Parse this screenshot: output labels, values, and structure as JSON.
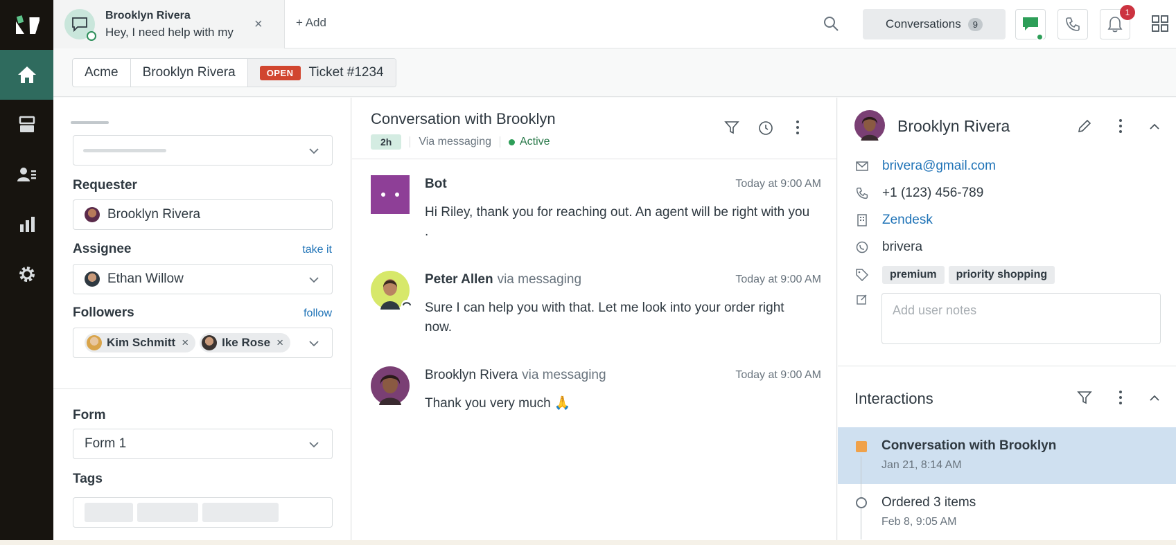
{
  "nav": {
    "items": [
      {
        "icon": "home-icon",
        "active": true
      },
      {
        "icon": "views-icon",
        "active": false
      },
      {
        "icon": "customers-icon",
        "active": false
      },
      {
        "icon": "reporting-icon",
        "active": false
      },
      {
        "icon": "settings-icon",
        "active": false
      }
    ]
  },
  "topbar": {
    "tab": {
      "name": "Brooklyn Rivera",
      "preview": "Hey, I need help with my"
    },
    "add_label": "+ Add",
    "conversations_label": "Conversations",
    "conversations_count": "9",
    "notification_count": "1"
  },
  "breadcrumb": {
    "org": "Acme",
    "requester": "Brooklyn Rivera",
    "status": "OPEN",
    "ticket": "Ticket #1234"
  },
  "ticket": {
    "requester_label": "Requester",
    "requester_value": "Brooklyn Rivera",
    "assignee_label": "Assignee",
    "assignee_link": "take it",
    "assignee_value": "Ethan Willow",
    "followers_label": "Followers",
    "followers_link": "follow",
    "followers": [
      "Kim Schmitt",
      "Ike Rose"
    ],
    "form_label": "Form",
    "form_value": "Form 1",
    "tags_label": "Tags"
  },
  "conversation": {
    "title": "Conversation with Brooklyn",
    "time_chip": "2h",
    "channel": "Via messaging",
    "status": "Active",
    "messages": [
      {
        "name": "Bot",
        "via": "",
        "time": "Today at 9:00 AM",
        "body": "Hi Riley, thank you for reaching out. An agent will be right with you ."
      },
      {
        "name": "Peter Allen",
        "via": "via messaging",
        "time": "Today at 9:00 AM",
        "body": "Sure I can help you with that. Let me look into your order right now."
      },
      {
        "name": "Brooklyn Rivera",
        "via": "via messaging",
        "time": "Today at 9:00 AM",
        "body": "Thank you very much 🙏"
      }
    ]
  },
  "user": {
    "name": "Brooklyn Rivera",
    "email": "brivera@gmail.com",
    "phone": "+1 (123) 456-789",
    "org": "Zendesk",
    "whatsapp": "brivera",
    "tags": [
      "premium",
      "priority shopping"
    ],
    "notes_placeholder": "Add user notes"
  },
  "interactions": {
    "title": "Interactions",
    "items": [
      {
        "title": "Conversation with Brooklyn",
        "date": "Jan 21, 8:14 AM",
        "selected": true
      },
      {
        "title": "Ordered 3 items",
        "date": "Feb 8, 9:05 AM",
        "selected": false
      }
    ]
  },
  "colors": {
    "accent": "#2f6b5e",
    "open_badge": "#d1462f",
    "link": "#1f73b7",
    "selected": "#cfe0f0"
  }
}
